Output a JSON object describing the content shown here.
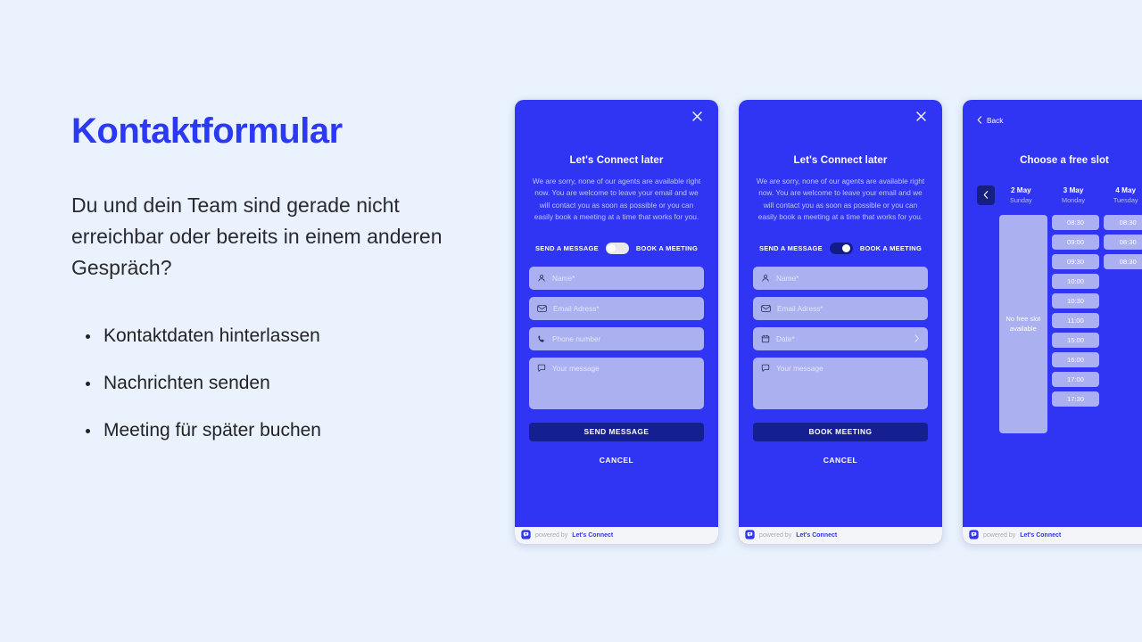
{
  "theme": {
    "background": "#eaf3fd",
    "brand_blue": "#2f35f3",
    "dark_blue": "#151f8f",
    "field_lilac": "#aab0f0",
    "title_blue": "#2b38f5"
  },
  "intro": {
    "title": "Kontaktformular",
    "paragraph": "Du und dein Team sind gerade nicht erreichbar oder bereits in einem anderen Gespräch?",
    "bullets": [
      "Kontaktdaten hinterlassen",
      "Nachrichten senden",
      "Meeting für später buchen"
    ]
  },
  "footer": {
    "powered_by": "powered by",
    "brand": "Let's Connect"
  },
  "card_message": {
    "close_icon": "close-icon",
    "title": "Let's Connect later",
    "description": "We are sorry, none of our agents are available right now. You are welcome to leave your email and we will contact you as soon as possible or you can easily book a meeting at a time that works for you.",
    "toggle": {
      "left_label": "SEND A MESSAGE",
      "right_label": "BOOK A MEETING",
      "state": "off"
    },
    "fields": [
      {
        "icon": "person-icon",
        "placeholder": "Name*"
      },
      {
        "icon": "envelope-icon",
        "placeholder": "Email Adress*"
      },
      {
        "icon": "phone-icon",
        "placeholder": "Phone number"
      },
      {
        "icon": "chat-icon",
        "placeholder": "Your message"
      }
    ],
    "primary_button": "SEND MESSAGE",
    "cancel_button": "CANCEL"
  },
  "card_meeting": {
    "close_icon": "close-icon",
    "title": "Let's Connect later",
    "description": "We are sorry, none of our agents are available right now. You are welcome to leave your email and we will contact you as soon as possible or you can easily book a meeting at a time that works for you.",
    "toggle": {
      "left_label": "SEND A MESSAGE",
      "right_label": "BOOK A MEETING",
      "state": "on"
    },
    "fields": [
      {
        "icon": "person-icon",
        "placeholder": "Name*"
      },
      {
        "icon": "envelope-icon",
        "placeholder": "Email Adress*"
      },
      {
        "icon": "calendar-icon",
        "placeholder": "Date*"
      },
      {
        "icon": "chat-icon",
        "placeholder": "Your message"
      }
    ],
    "primary_button": "BOOK MEETING",
    "cancel_button": "CANCEL"
  },
  "card_slots": {
    "back_label": "Back",
    "title": "Choose a free slot",
    "prev_icon": "chevron-left-icon",
    "days": [
      {
        "date": "2 May",
        "weekday": "Sunday"
      },
      {
        "date": "3 May",
        "weekday": "Monday"
      },
      {
        "date": "4 May",
        "weekday": "Tuesday"
      }
    ],
    "columns": [
      {
        "empty_text": "No free slot available",
        "slots": []
      },
      {
        "empty_text": "",
        "slots": [
          "08:30",
          "09:00",
          "09:30",
          "10:00",
          "10:30",
          "11:00",
          "15:00",
          "16:00",
          "17:00",
          "17:30"
        ]
      },
      {
        "empty_text": "",
        "slots": [
          "08:30",
          "08:30",
          "08:30"
        ]
      }
    ]
  }
}
